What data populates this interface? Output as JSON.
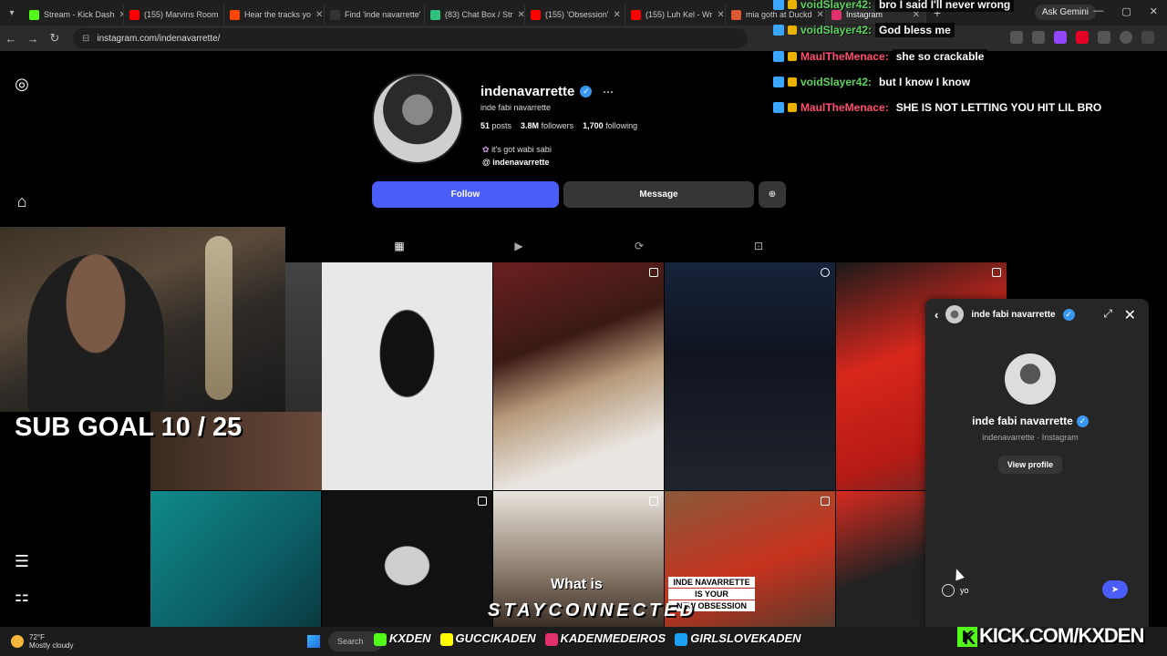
{
  "browser": {
    "tabs": [
      {
        "label": "Stream - Kick Dash",
        "color": "#53fc18"
      },
      {
        "label": "(155) Marvins Room",
        "color": "#ff0000"
      },
      {
        "label": "Hear the tracks yo",
        "color": "#ff4500"
      },
      {
        "label": "Find 'inde navarrette'",
        "color": "#111111"
      },
      {
        "label": "(83) Chat Box / Str",
        "color": "#2ec27e"
      },
      {
        "label": "(155) 'Obsession'",
        "color": "#ff0000"
      },
      {
        "label": "(155) Luh Kel - Wr",
        "color": "#ff0000"
      },
      {
        "label": "mia goth at Duckd",
        "color": "#de5833"
      },
      {
        "label": "Instagram",
        "color": "#e1306c"
      }
    ],
    "ask_gemini": "Ask Gemini",
    "url": "instagram.com/indenavarrette/"
  },
  "profile": {
    "username": "indenavarrette",
    "full_name": "inde fabi navarrette",
    "posts_count": "51",
    "posts_label": "posts",
    "followers_count": "3.8M",
    "followers_label": "followers",
    "following_count": "1,700",
    "following_label": "following",
    "bio": "it's got wabi sabi",
    "threads_handle": "indenavarrette",
    "follow_label": "Follow",
    "message_label": "Message"
  },
  "chat": [
    {
      "user": "voidSlayer42:",
      "color": "#5fd35f",
      "message": "bro I said I'll never wrong"
    },
    {
      "user": "voidSlayer42:",
      "color": "#5fd35f",
      "message": "God bless me"
    },
    {
      "user": "MaulTheMenace:",
      "color": "#ff4d6d",
      "message": "she so crackable"
    },
    {
      "user": "voidSlayer42:",
      "color": "#5fd35f",
      "message": "but I know I know"
    },
    {
      "user": "MaulTheMenace:",
      "color": "#ff4d6d",
      "message": "SHE IS NOT LETTING YOU HIT LIL BRO"
    }
  ],
  "overlay": {
    "sub_goal": "SUB GOAL 10 / 25",
    "stay_connected": "STAYCONNECTED",
    "kick_url": "KICK.COM/KXDEN",
    "socials": [
      "KXDEN",
      "GUCCIKADEN",
      "KADENMEDEIROS",
      "GIRLSLOVEKADEN"
    ],
    "post_text_what": "What is",
    "post_text_obsession": [
      "INDE NAVARRETTE",
      "IS YOUR",
      "NEW OBSESSION"
    ]
  },
  "dm": {
    "header_name": "inde fabi navarrette",
    "name": "inde fabi navarrette",
    "subtitle": "indenavarrette · Instagram",
    "view_profile": "View profile",
    "input_value": "yo"
  },
  "taskbar": {
    "temperature": "72°F",
    "condition": "Mostly cloudy",
    "search": "Search"
  }
}
